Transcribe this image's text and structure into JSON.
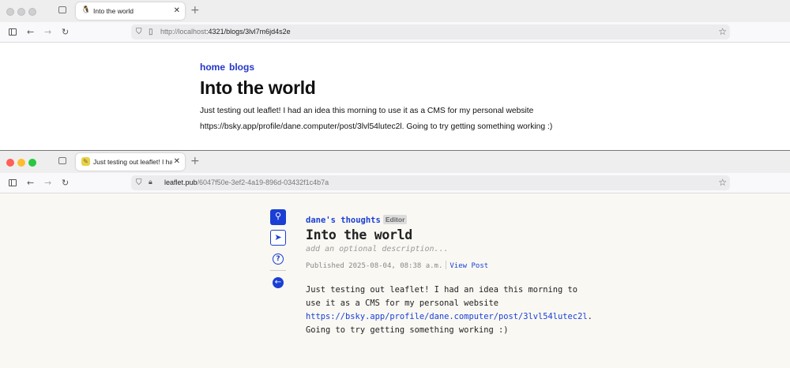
{
  "window1": {
    "tab_title": "Into the world",
    "tab_favicon": "penguin-icon",
    "url_host": "http://localhost",
    "url_rest": ":4321/blogs/3lvl7m6jd4s2e",
    "page": {
      "breadcrumbs": [
        "home",
        "blogs"
      ],
      "title": "Into the world",
      "body": "Just testing out leaflet! I had an idea this morning to use it as a CMS for my personal website https://bsky.app/profile/dane.computer/post/3lvl54lutec2l. Going to try getting something working :)"
    }
  },
  "window2": {
    "tab_title": "Just testing out leaflet! I had an i",
    "tab_favicon": "leaflet-icon",
    "url_host": "leaflet.pub",
    "url_rest": "/6047f50e-3ef2-4a19-896d-03432f1c4b7a",
    "page": {
      "publication_name": "dane's thoughts",
      "editor_badge": "Editor",
      "title": "Into the world",
      "description_placeholder": "add an optional description...",
      "published": "Published 2025-08-04, 08:38 a.m.",
      "view_post": "View Post",
      "body_before": "Just testing out leaflet! I had an idea this morning to use it as a CMS for my personal website ",
      "body_link": "https://bsky.app/profile/dane.computer/post/3lvl54lutec2l",
      "body_after": ". Going to try getting something working :)"
    },
    "toolbar": [
      "publication-search-icon",
      "send-icon",
      "help-icon",
      "back-arrow-icon"
    ]
  },
  "colors": {
    "accent_blue": "#1b3fd4",
    "blog_link_blue": "#2336c8",
    "leaflet_bg": "#f9f8f3"
  }
}
